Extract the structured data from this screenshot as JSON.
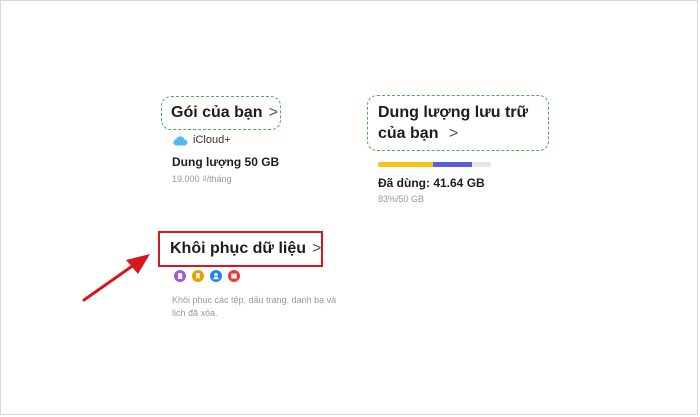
{
  "plan": {
    "title": "Gói của bạn",
    "chevron": ">",
    "service_icon": "icloud-icon",
    "service_name": "iCloud+",
    "capacity": "Dung lượng 50 GB",
    "price": "19.000 ₫/tháng"
  },
  "storage": {
    "title_line1": "Dung lượng lưu trữ",
    "title_line2": "của bạn",
    "chevron": ">",
    "used": "Đã dùng: 41.64 GB",
    "percent_text": "83%/50 GB",
    "segments": [
      {
        "color": "#f5c518",
        "fraction": 0.49
      },
      {
        "color": "#5b5fd6",
        "fraction": 0.34
      },
      {
        "color": "#e5e5e5",
        "fraction": 0.17
      }
    ]
  },
  "restore": {
    "title": "Khôi phục dữ liệu",
    "chevron": ">",
    "icons": [
      {
        "name": "files-icon",
        "color": "#a35bd8"
      },
      {
        "name": "bookmarks-icon",
        "color": "#f59b00"
      },
      {
        "name": "contacts-icon",
        "color": "#1e88e5"
      },
      {
        "name": "calendar-icon",
        "color": "#e53935"
      }
    ],
    "description": "Khôi phục các tệp, dấu trang, danh bạ và lịch đã xóa."
  },
  "colors": {
    "highlight_box": "#d6181e",
    "dashed_outline": "#4cae4c",
    "arrow": "#d6181e"
  }
}
